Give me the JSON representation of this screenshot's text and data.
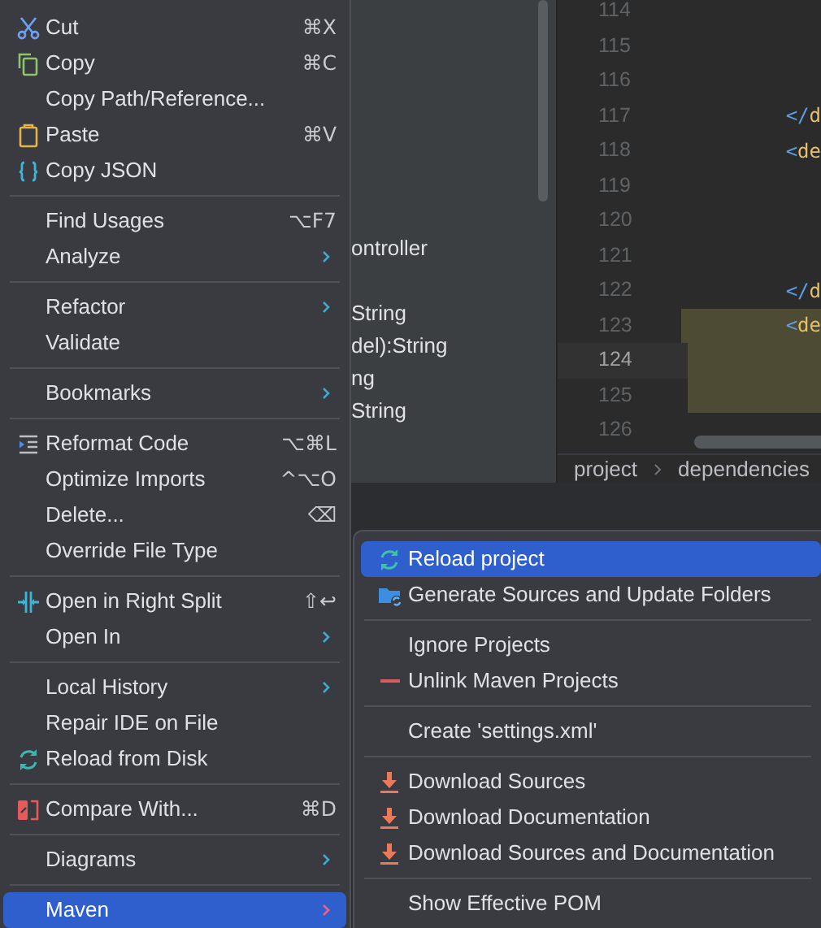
{
  "project_panel": {
    "texts": [
      "ontroller",
      "String",
      "del):String",
      "ng",
      "String"
    ]
  },
  "editor": {
    "lines": [
      {
        "number": "114",
        "current": false,
        "highlighted": false
      },
      {
        "number": "115",
        "current": false,
        "highlighted": false
      },
      {
        "number": "116",
        "current": false,
        "highlighted": false
      },
      {
        "number": "117",
        "current": false,
        "highlighted": false,
        "bracket": "</",
        "tag": "d"
      },
      {
        "number": "118",
        "current": false,
        "highlighted": false,
        "bracket": "<",
        "tag": "de"
      },
      {
        "number": "119",
        "current": false,
        "highlighted": false
      },
      {
        "number": "120",
        "current": false,
        "highlighted": false
      },
      {
        "number": "121",
        "current": false,
        "highlighted": false
      },
      {
        "number": "122",
        "current": false,
        "highlighted": false,
        "bracket": "</",
        "tag": "d"
      },
      {
        "number": "123",
        "current": false,
        "highlighted": true,
        "bracket": "<",
        "tag": "de"
      },
      {
        "number": "124",
        "current": true,
        "highlighted": true
      },
      {
        "number": "125",
        "current": false,
        "highlighted": true
      },
      {
        "number": "126",
        "current": false,
        "highlighted": false
      }
    ],
    "breadcrumbs": [
      "project",
      "dependencies"
    ]
  },
  "context_menu": {
    "groups": [
      [
        {
          "label": "Cut",
          "shortcut": "⌘X",
          "submenu": false,
          "selected": false
        },
        {
          "label": "Copy",
          "shortcut": "⌘C",
          "submenu": false,
          "selected": false
        },
        {
          "label": "Copy Path/Reference...",
          "submenu": false,
          "selected": false
        },
        {
          "label": "Paste",
          "shortcut": "⌘V",
          "submenu": false,
          "selected": false
        },
        {
          "label": "Copy JSON",
          "submenu": false,
          "selected": false
        }
      ],
      [
        {
          "label": "Find Usages",
          "shortcut": "⌥F7",
          "submenu": false,
          "selected": false
        },
        {
          "label": "Analyze",
          "submenu": true,
          "selected": false
        }
      ],
      [
        {
          "label": "Refactor",
          "submenu": true,
          "selected": false
        },
        {
          "label": "Validate",
          "submenu": false,
          "selected": false
        }
      ],
      [
        {
          "label": "Bookmarks",
          "submenu": true,
          "selected": false
        }
      ],
      [
        {
          "label": "Reformat Code",
          "shortcut": "⌥⌘L",
          "submenu": false,
          "selected": false
        },
        {
          "label": "Optimize Imports",
          "shortcut": "^⌥O",
          "submenu": false,
          "selected": false
        },
        {
          "label": "Delete...",
          "shortcut": "⌫",
          "submenu": false,
          "selected": false
        },
        {
          "label": "Override File Type",
          "submenu": false,
          "selected": false
        }
      ],
      [
        {
          "label": "Open in Right Split",
          "shortcut": "⇧↩",
          "submenu": false,
          "selected": false
        },
        {
          "label": "Open In",
          "submenu": true,
          "selected": false
        }
      ],
      [
        {
          "label": "Local History",
          "submenu": true,
          "selected": false
        },
        {
          "label": "Repair IDE on File",
          "submenu": false,
          "selected": false
        },
        {
          "label": "Reload from Disk",
          "submenu": false,
          "selected": false
        }
      ],
      [
        {
          "label": "Compare With...",
          "shortcut": "⌘D",
          "submenu": false,
          "selected": false
        }
      ],
      [
        {
          "label": "Diagrams",
          "submenu": true,
          "selected": false
        }
      ],
      [
        {
          "label": "Maven",
          "submenu": true,
          "selected": true
        }
      ]
    ]
  },
  "maven_submenu": {
    "groups": [
      [
        {
          "label": "Reload project",
          "selected": true
        },
        {
          "label": "Generate Sources and Update Folders",
          "selected": false
        }
      ],
      [
        {
          "label": "Ignore Projects",
          "selected": false
        },
        {
          "label": "Unlink Maven Projects",
          "selected": false
        }
      ],
      [
        {
          "label": "Create 'settings.xml'",
          "selected": false
        }
      ],
      [
        {
          "label": "Download Sources",
          "selected": false
        },
        {
          "label": "Download Documentation",
          "selected": false
        },
        {
          "label": "Download Sources and Documentation",
          "selected": false
        }
      ],
      [
        {
          "label": "Show Effective POM",
          "selected": false
        }
      ]
    ]
  }
}
